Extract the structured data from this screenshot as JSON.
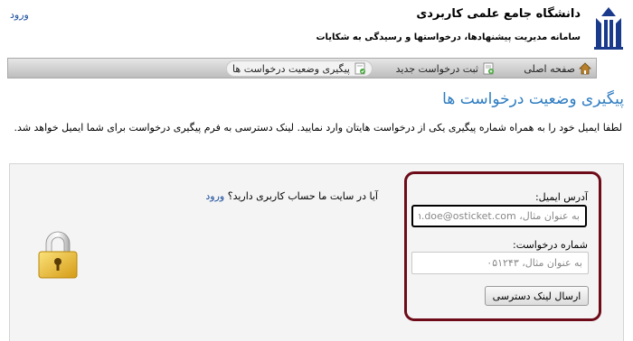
{
  "header": {
    "university_name": "دانشگاه جامع علمی کاربردی",
    "system_subtitle": "سامانه مدیریت پیشنهادها، درخواستها و رسیدگی به شکایات",
    "login_link": "ورود"
  },
  "nav": {
    "items": [
      {
        "label": "صفحه اصلی",
        "icon": "home-icon"
      },
      {
        "label": "ثبت درخواست جدید",
        "icon": "new-ticket-icon"
      },
      {
        "label": "پیگیری وضعیت درخواست ها",
        "icon": "check-status-icon",
        "active": true
      }
    ]
  },
  "main": {
    "title": "پیگیری وضعیت درخواست ها",
    "intro": "لطفا ایمیل خود را به همراه شماره پیگیری یکی از درخواست هایتان وارد نمایید. لینک دسترسی به فرم پیگیری درخواست برای شما ایمیل خواهد شد."
  },
  "form": {
    "email_label": "آدرس ایمیل:",
    "email_placeholder": "به عنوان مثال، john.doe@osticket.com",
    "ticket_label": "شماره درخواست:",
    "ticket_placeholder": "به عنوان مثال، ۰۵۱۲۴۳",
    "submit_label": "ارسال لینک دسترسی"
  },
  "account": {
    "question": "آیا در سایت ما حساب کاربری دارید؟",
    "login_link": "ورود"
  },
  "colors": {
    "accent_title": "#2d7cc1",
    "link": "#1b4e9a",
    "form_border": "#6e0b19"
  }
}
